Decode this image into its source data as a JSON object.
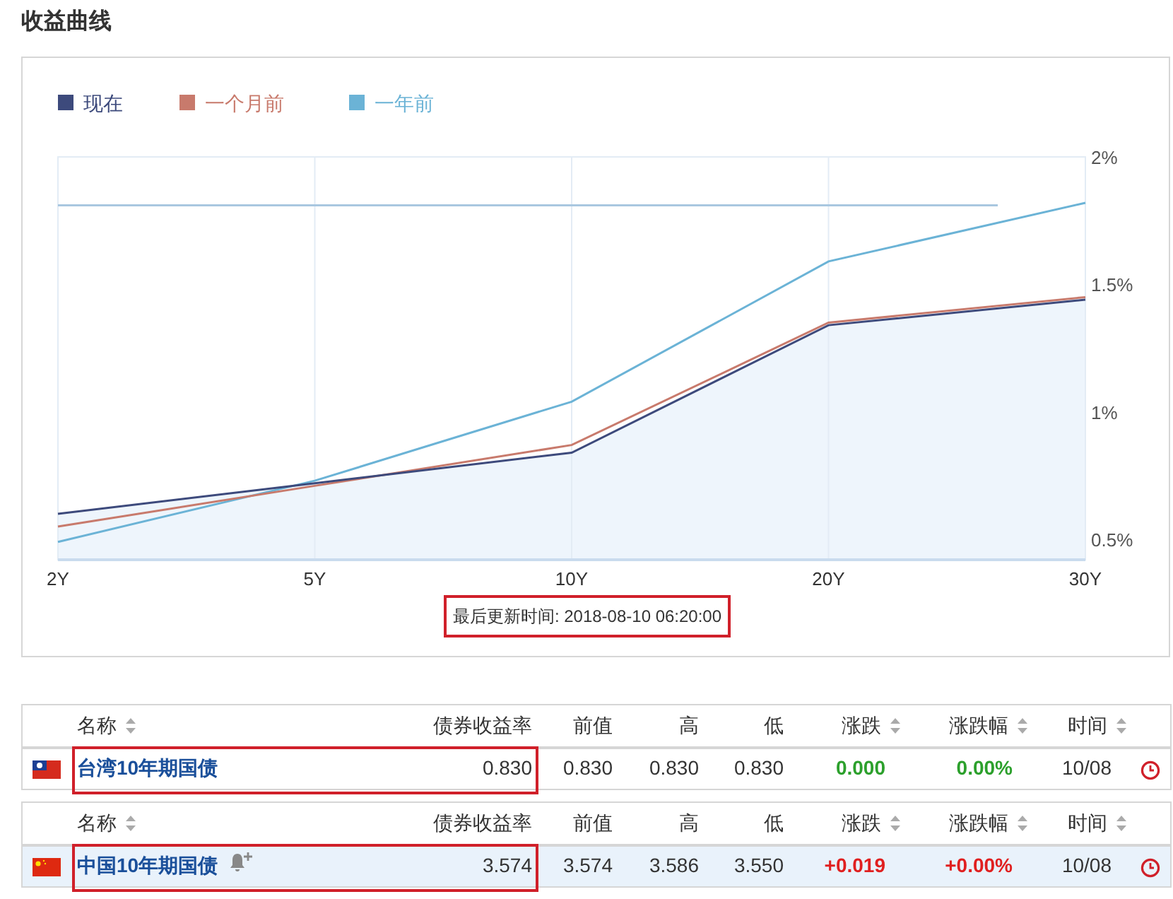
{
  "title": "收益曲线",
  "chart": {
    "chart_data": {
      "type": "line",
      "categories": [
        "2Y",
        "5Y",
        "10Y",
        "20Y",
        "30Y"
      ],
      "ylim": [
        0.42,
        2.0
      ],
      "yticks": [
        {
          "value": 0.5,
          "label": "0.5%"
        },
        {
          "value": 1,
          "label": "1%"
        },
        {
          "value": 1.5,
          "label": "1.5%"
        },
        {
          "value": 2,
          "label": "2%"
        }
      ],
      "series": [
        {
          "name": "现在",
          "color": "#3d4a7c",
          "values": [
            0.6,
            0.72,
            0.84,
            1.34,
            1.44
          ]
        },
        {
          "name": "一个月前",
          "color": "#c87a6c",
          "values": [
            0.55,
            0.71,
            0.87,
            1.35,
            1.45
          ]
        },
        {
          "name": "一年前",
          "color": "#6bb3d6",
          "values": [
            0.49,
            0.73,
            1.04,
            1.59,
            1.82
          ]
        }
      ],
      "ref_lines": [
        {
          "axis": "y",
          "value": 1.81
        }
      ],
      "grid": "x",
      "legend": true
    },
    "updated": {
      "text": "最后更新时间: 2018-08-10 06:20:00",
      "highlighted": true
    }
  },
  "tables": [
    {
      "columns": [
        "名称",
        "债券收益率",
        "前值",
        "高",
        "低",
        "涨跌",
        "涨跌幅",
        "时间"
      ],
      "rows": [
        {
          "flag": {
            "kind": "taiwan"
          },
          "name": "台湾10年期国债",
          "alert": false,
          "yield": "0.830",
          "prev": "0.830",
          "high": "0.830",
          "low": "0.830",
          "change": "0.000",
          "change_pct": "0.00%",
          "color": "#2ca02c",
          "time": "10/08",
          "selected": false,
          "highlighted": true
        }
      ]
    },
    {
      "columns": [
        "名称",
        "债券收益率",
        "前值",
        "高",
        "低",
        "涨跌",
        "涨跌幅",
        "时间"
      ],
      "rows": [
        {
          "flag": {
            "kind": "china"
          },
          "name": "中国10年期国债",
          "alert": true,
          "yield": "3.574",
          "prev": "3.574",
          "high": "3.586",
          "low": "3.550",
          "change": "+0.019",
          "change_pct": "+0.00%",
          "color": "#e02020",
          "time": "10/08",
          "selected": true,
          "highlighted": true
        }
      ]
    }
  ]
}
